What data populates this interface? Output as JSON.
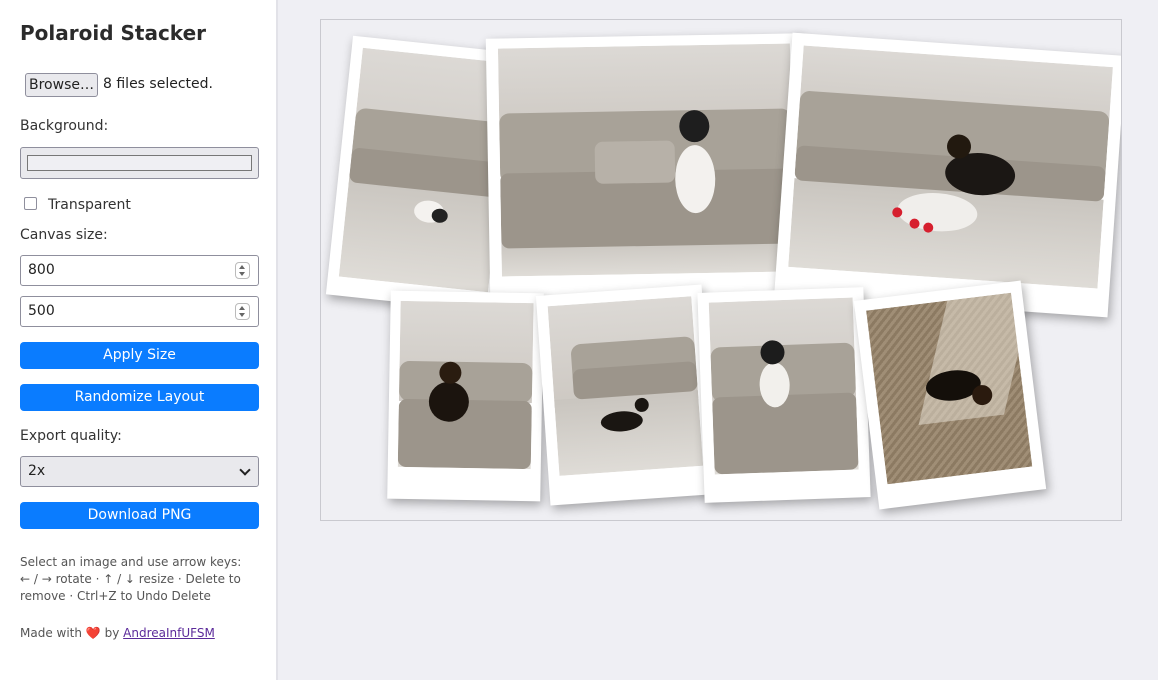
{
  "app": {
    "title": "Polaroid Stacker"
  },
  "file_input": {
    "button_label": "Browse…",
    "status": "8 files selected."
  },
  "background": {
    "label": "Background:",
    "color": "#efeff3"
  },
  "transparent": {
    "label": "Transparent",
    "checked": false
  },
  "canvas_size": {
    "label": "Canvas size:",
    "width": "800",
    "height": "500"
  },
  "buttons": {
    "apply_size": "Apply Size",
    "randomize": "Randomize Layout",
    "download": "Download PNG"
  },
  "export_quality": {
    "label": "Export quality:",
    "selected": "2x"
  },
  "help_text": "Select an image and use arrow keys: ← / → rotate · ↑ / ↓ resize · Delete to remove · Ctrl+Z to Undo Delete",
  "footer": {
    "made_with": "Made with",
    "heart": "❤️",
    "by": "by",
    "author": "AndreaInfUFSM"
  },
  "colors": {
    "accent": "#0a7cff",
    "sidebar_bg": "#ffffff",
    "page_bg": "#efeff4"
  }
}
